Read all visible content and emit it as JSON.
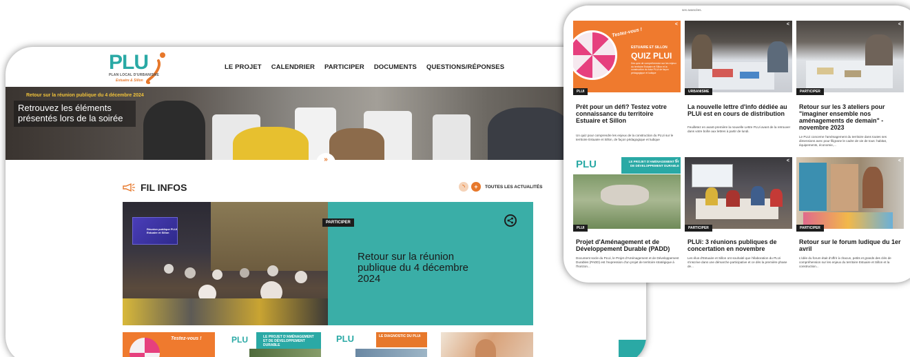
{
  "site": {
    "logo_word": "PLU",
    "logo_i": "i",
    "logo_sub": "PLAN LOCAL D'URBANISME",
    "logo_sub2": "Estuaire & Sillon"
  },
  "nav": {
    "items": [
      "LE PROJET",
      "CALENDRIER",
      "PARTICIPER",
      "DOCUMENTS",
      "QUESTIONS/RÉPONSES"
    ]
  },
  "hero": {
    "tag": "Retour sur la réunion publique du 4 décembre 2024",
    "title": "Retrouvez les éléments présentés lors de la soirée",
    "chevron_icon": "chevron-down-double-icon"
  },
  "fil_infos": {
    "icon": "megaphone-icon",
    "title": "FIL INFOS",
    "rss_icon": "rss-icon",
    "plus_icon": "plus-icon",
    "all_news_label": "TOUTES LES ACTUALITÉS"
  },
  "feature": {
    "category": "PARTICIPER",
    "title": "Retour sur la réunion publique du 4 décembre 2024",
    "share_icon": "share-icon",
    "screen_text": "Réunion publique PLUi Estuaire et Sillon",
    "screen_logo": "estuaire"
  },
  "thumbs": [
    {
      "name": "quiz-thumb",
      "text": "Testez-vous !"
    },
    {
      "name": "padd-thumb",
      "text": "LE PROJET D'AMÉNAGEMENT ET DE DÉVELOPPEMENT DURABLE"
    },
    {
      "name": "diagnostic-thumb",
      "text": "LE DIAGNOSTIC DU PLUi"
    },
    {
      "name": "photo-thumb",
      "text": ""
    }
  ],
  "right_top_snippet": "ses avancées.",
  "tiles": [
    {
      "category": "PLUI",
      "title": "Prêt pour un défi? Testez votre connaissance du territoire Estuaire et Sillon",
      "excerpt": "Un quiz pour comprendre les enjeux de la construction du PLUi sur le territoire Estuaire et Sillon, de façon pédagogique et ludique",
      "img_label_1": "ESTUAIRE ET SILLON",
      "img_label_2": "QUIZ PLUI",
      "img_script": "Testez-vous !",
      "img_caption": "Des quiz de compréhension sur les enjeux du territoire Estuaire et Sillon et la construction du futur PLUi de façon pédagogique et ludique"
    },
    {
      "category": "URBANISME",
      "title": "La nouvelle lettre d'info dédiée au PLUi est en cours de distribution",
      "excerpt": "Feuilletez en avant-première la nouvelle Lettre PLUi avant de la retrouver dans votre boîte aux lettres à partir de lundi."
    },
    {
      "category": "PARTICIPER",
      "title": "Retour sur les 3 ateliers pour \"imaginer ensemble nos aménagements de demain\" - novembre 2023",
      "excerpt": "Le PLUi concerne l'aménagement du territoire dans toutes ses dimensions avec pour filigrane le cadre de vie de tous: habitat, équipements, économie,..."
    },
    {
      "category": "PLUI",
      "title": "Projet d'Aménagement et de Développement Durable (PADD)",
      "excerpt": "Document socle du PLUi, le Projet d'Aménagement et de Développement Durables (PADD) est l'expression d'un projet de territoire stratégique à l'horizon...",
      "img_label": "LE PROJET D'AMÉNAGEMENT ET DE DÉVELOPPEMENT DURABLE"
    },
    {
      "category": "PARTICIPER",
      "title": "PLUi: 3 réunions publiques de concertation en novembre",
      "excerpt": "Les élus d'Estuaire et Sillon ont souhaité que l'élaboration du PLUi s'inscrive dans une démarche participative et ce dès la première phase de..."
    },
    {
      "category": "PARTICIPER",
      "title": "Retour sur le forum ludique du 1er avril",
      "excerpt": "L'idée du forum était d'offrir à chacun, petits et grands des clés de compréhension sur les enjeux du territoire Estuaire et Sillon et la construction..."
    }
  ],
  "colors": {
    "teal": "#2aa9a5",
    "orange": "#e7782b",
    "feature_teal": "#3aaea7",
    "dark": "#1d1d1d",
    "hero_tag": "#f0c23a"
  }
}
